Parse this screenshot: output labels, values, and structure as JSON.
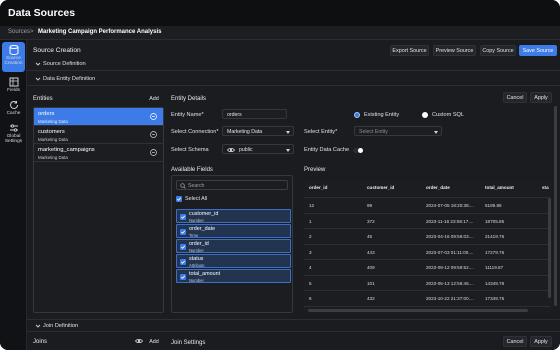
{
  "app": {
    "title": "Data Sources"
  },
  "breadcrumb": {
    "root": "Sources",
    "separator": ">",
    "current": "Marketing Campaign Performance Analysis"
  },
  "rail": [
    {
      "label_1": "Source",
      "label_2": "Creation",
      "icon": "database-icon",
      "active": true
    },
    {
      "label_1": "Fields",
      "label_2": "",
      "icon": "fields-icon",
      "active": false
    },
    {
      "label_1": "Cache",
      "label_2": "",
      "icon": "refresh-icon",
      "active": false
    },
    {
      "label_1": "Global",
      "label_2": "Settings",
      "icon": "settings-icon",
      "active": false
    }
  ],
  "header": {
    "title": "Source Creation",
    "export": "Export Source",
    "preview": "Preview Source",
    "copy": "Copy Source",
    "save": "Save Source"
  },
  "sections": {
    "source_definition": "Source Definition",
    "data_entity_definition": "Data Entity Definition",
    "join_definition": "Join Definition"
  },
  "entities": {
    "title": "Entities",
    "add": "Add",
    "items": [
      {
        "name": "orders",
        "sub": "Marketing Data",
        "selected": true
      },
      {
        "name": "customers",
        "sub": "Marketing Data",
        "selected": false
      },
      {
        "name": "marketing_campaigns",
        "sub": "Marketing Data",
        "selected": false
      }
    ]
  },
  "details": {
    "title": "Entity Details",
    "cancel": "Cancel",
    "apply": "Apply",
    "entity_name_label": "Entity Name*",
    "entity_name_value": "orders",
    "existing_entity": "Existing Entity",
    "custom_sql": "Custom SQL",
    "select_connection_label": "Select Connection*",
    "connection_value": "Marketing Data",
    "select_entity_label": "Select Entity*",
    "entity_placeholder": "Select Entity",
    "select_schema_label": "Select Schema",
    "schema_value": "public",
    "entity_cache_label": "Entity Data Cache"
  },
  "available_fields": {
    "title": "Available Fields",
    "search_placeholder": "Search",
    "select_all": "Select All",
    "items": [
      {
        "name": "customer_id",
        "type": "Number"
      },
      {
        "name": "order_date",
        "type": "Time"
      },
      {
        "name": "order_id",
        "type": "Number"
      },
      {
        "name": "status",
        "type": "Attribute"
      },
      {
        "name": "total_amount",
        "type": "Number"
      }
    ]
  },
  "preview": {
    "title": "Preview",
    "columns": [
      "order_id",
      "customer_id",
      "order_date",
      "total_amount",
      "sta"
    ],
    "rows": [
      [
        "12",
        "99",
        "2024-07-05 18:20:38....",
        "6189.86",
        ""
      ],
      [
        "1",
        "372",
        "2023-11-16 23:59:17....",
        "18705.85",
        ""
      ],
      [
        "2",
        "45",
        "2023-04-16 09:56:03....",
        "21419.76",
        ""
      ],
      [
        "3",
        "443",
        "2023-07-03 01:11:00....",
        "17279.76",
        ""
      ],
      [
        "4",
        "409",
        "2023-09-12 09:59:52....",
        "11119.87",
        ""
      ],
      [
        "5",
        "101",
        "2023-05-13 12:56:46....",
        "14349.78",
        ""
      ],
      [
        "6",
        "432",
        "2023-10-22 21:37:00....",
        "17349.75",
        ""
      ]
    ]
  },
  "joins": {
    "title": "Joins",
    "add": "Add",
    "settings_title": "Join Settings",
    "cancel": "Cancel",
    "apply": "Apply"
  },
  "colors": {
    "accent": "#3c7be8",
    "background": "#1a1c20",
    "topbar": "#0e0f11"
  }
}
